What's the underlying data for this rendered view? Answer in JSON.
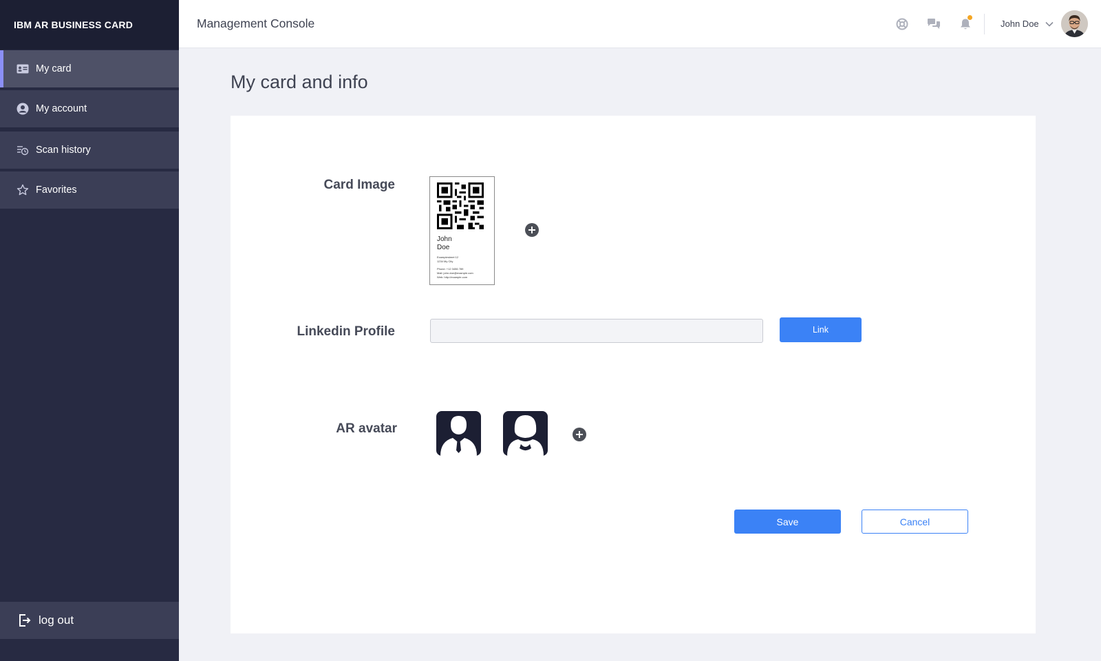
{
  "app": {
    "brand": "IBM AR BUSINESS CARD",
    "console_title": "Management Console"
  },
  "sidebar": {
    "items": [
      {
        "label": "My card",
        "icon": "id-card-icon",
        "active": true
      },
      {
        "label": "My account",
        "icon": "user-circle-icon",
        "active": false
      },
      {
        "label": "Scan history",
        "icon": "history-icon",
        "active": false
      },
      {
        "label": "Favorites",
        "icon": "star-icon",
        "active": false
      }
    ],
    "logout_label": "log out"
  },
  "header": {
    "icons": [
      "help-icon",
      "chat-icon",
      "bell-icon"
    ],
    "user_name": "John Doe"
  },
  "main": {
    "page_title": "My card and info",
    "card_image_label": "Card Image",
    "card": {
      "first_name": "John",
      "last_name": "Doe",
      "address_line1": "Examplestreet 12",
      "address_line2": "1234 My City",
      "phone": "Phone: +12 3456 789",
      "mail": "Mail: john.doe@example.com",
      "web": "Web: http://example.com"
    },
    "linkedin_label": "Linkedin Profile",
    "linkedin_value": "",
    "link_button": "Link",
    "ar_avatar_label": "AR avatar",
    "avatars": [
      "male-avatar-icon",
      "female-avatar-icon"
    ],
    "save_button": "Save",
    "cancel_button": "Cancel"
  },
  "colors": {
    "sidebar": "#272a42",
    "accent": "#3b82f6",
    "active_indicator": "#8b8ff7",
    "notification": "#f5a623"
  }
}
